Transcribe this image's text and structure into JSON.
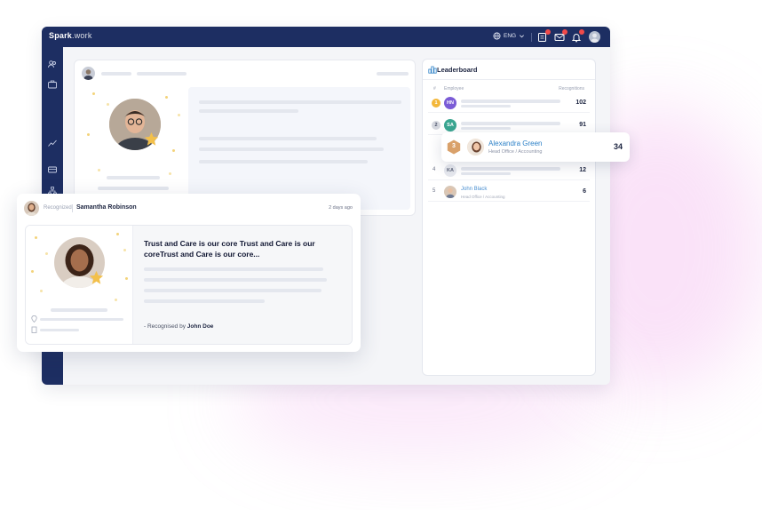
{
  "brand": {
    "name_bold": "Spark",
    "name_light": ".work"
  },
  "topbar": {
    "language": "ENG",
    "icons": [
      "globe-icon",
      "chevron-down-icon",
      "tasks-icon",
      "mail-icon",
      "bell-icon",
      "user-avatar"
    ]
  },
  "sidenav": {
    "icons": [
      "people-icon",
      "briefcase-icon",
      "chart-icon",
      "suitcase-icon",
      "hierarchy-icon"
    ]
  },
  "leaderboard": {
    "title": "Leaderboard",
    "col_employee": "Employee",
    "col_recognitions": "Recognitions",
    "rows": [
      {
        "rank": "1",
        "initials": "HN",
        "score": "102",
        "avatar_color": "#7b5cd6",
        "badge_color": "#f3b73a"
      },
      {
        "rank": "2",
        "initials": "SA",
        "score": "91",
        "avatar_color": "#3aa691",
        "badge_color": "#d4d7de"
      },
      {
        "rank": "4",
        "initials": "KA",
        "score": "12",
        "avatar_color": "#e6e8ee"
      },
      {
        "rank": "5",
        "name": "John Black",
        "subtitle": "Head Office / Accounting",
        "score": "6"
      }
    ]
  },
  "highlight": {
    "rank": "3",
    "name": "Alexandra Green",
    "subtitle": "Head Office / Accounting",
    "score": "34"
  },
  "recognition": {
    "label": "Recognized",
    "name": "Samantha Robinson",
    "time": "2 days ago",
    "message": "Trust and Care is our core Trust and Care is our coreTrust and Care is our core...",
    "by_prefix": "- Recognised by",
    "by_name": "John Doe"
  },
  "colors": {
    "navy": "#1d2e62",
    "accent_blue": "#2e82c8",
    "gold": "#f3b73a",
    "bronze": "#d9a16a",
    "glow_pink": "#ec96e6"
  }
}
